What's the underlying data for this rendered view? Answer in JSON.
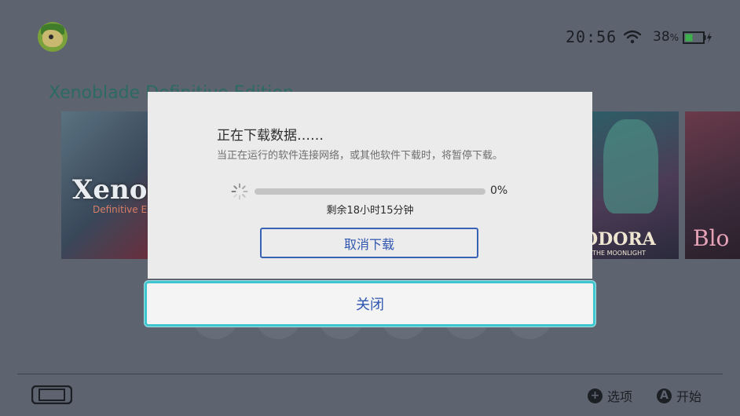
{
  "status_bar": {
    "time": "20:56",
    "battery_percent": "38",
    "battery_unit": "%",
    "icons": [
      "wifi-icon",
      "battery-charging-icon"
    ]
  },
  "user": {
    "avatar_icon": "user-avatar-icon"
  },
  "home": {
    "selected_game_title": "Xenoblade Definitive Edition",
    "tiles": [
      {
        "logo": "Xenob",
        "sub": "Definitive E"
      },
      {
        "logo": "ODORA",
        "sub": "R THE MOONLIGHT"
      },
      {
        "logo": "Blo"
      }
    ]
  },
  "dialog": {
    "title": "正在下载数据……",
    "description": "当正在运行的软件连接网络，或其他软件下载时，将暂停下载。",
    "progress_percent_label": "0%",
    "progress_fraction": 0.0,
    "remaining": "剩余18小时15分钟",
    "cancel_label": "取消下载",
    "close_label": "关闭"
  },
  "bottom_bar": {
    "options_glyph": "+",
    "options_label": "选项",
    "start_glyph": "A",
    "start_label": "开始",
    "console_icon": "handheld-console-icon"
  },
  "colors": {
    "background": "#5d6470",
    "dialog_bg": "#ebebeb",
    "accent_blue": "#2f55b0",
    "focus_cyan": "#3fc5cd",
    "title_teal": "#2c6a62"
  }
}
